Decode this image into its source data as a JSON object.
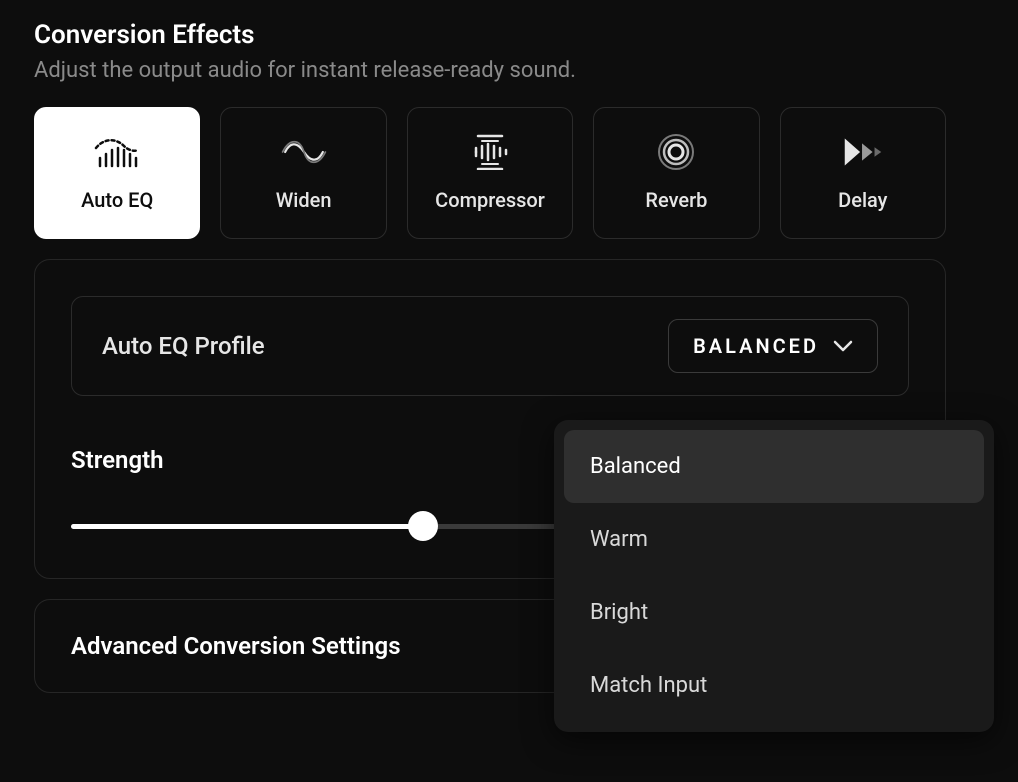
{
  "header": {
    "title": "Conversion Effects",
    "subtitle": "Adjust the output audio for instant release-ready sound."
  },
  "effects": [
    {
      "id": "auto-eq",
      "label": "Auto EQ",
      "active": true
    },
    {
      "id": "widen",
      "label": "Widen",
      "active": false
    },
    {
      "id": "compressor",
      "label": "Compressor",
      "active": false
    },
    {
      "id": "reverb",
      "label": "Reverb",
      "active": false
    },
    {
      "id": "delay",
      "label": "Delay",
      "active": false
    }
  ],
  "profile": {
    "label": "Auto EQ Profile",
    "selected": "Balanced",
    "options": [
      "Balanced",
      "Warm",
      "Bright",
      "Match Input"
    ]
  },
  "strength": {
    "label": "Strength",
    "value": 42
  },
  "advanced": {
    "title": "Advanced Conversion Settings"
  }
}
